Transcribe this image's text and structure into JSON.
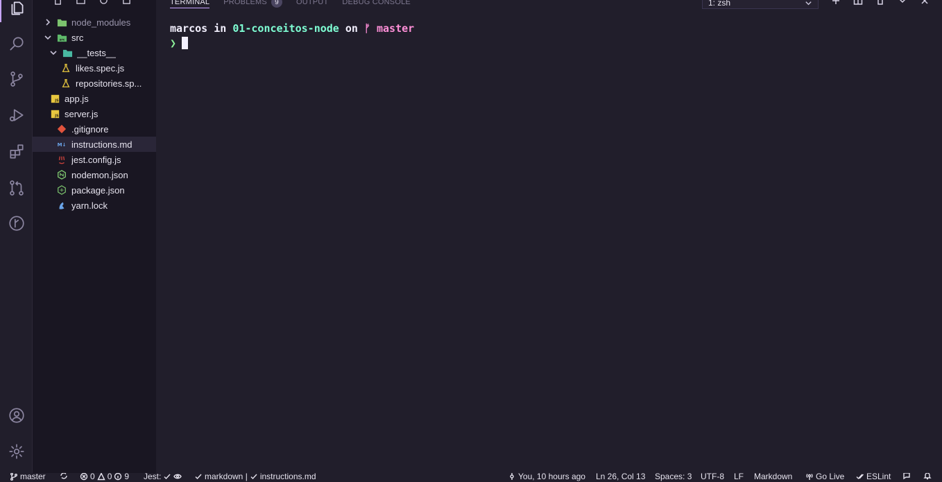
{
  "activity_bar": {
    "items": [
      {
        "icon": "explorer-icon",
        "active": true
      },
      {
        "icon": "search-icon"
      },
      {
        "icon": "source-control-icon"
      },
      {
        "icon": "run-debug-icon"
      },
      {
        "icon": "extensions-icon"
      },
      {
        "icon": "pull-request-icon"
      },
      {
        "icon": "git-graph-icon"
      }
    ],
    "bottom": [
      {
        "icon": "account-icon"
      },
      {
        "icon": "gear-icon"
      }
    ]
  },
  "explorer": {
    "tree": [
      {
        "label": "node_modules",
        "icon": "folder-node-icon",
        "chevron": "right",
        "indent": 1,
        "dim": true
      },
      {
        "label": "src",
        "icon": "folder-src-icon",
        "chevron": "down",
        "indent": 1
      },
      {
        "label": "__tests__",
        "icon": "folder-tests-icon",
        "chevron": "down",
        "indent": 2
      },
      {
        "label": "likes.spec.js",
        "icon": "test-flask-icon",
        "indent": 3
      },
      {
        "label": "repositories.sp...",
        "icon": "test-flask-icon",
        "indent": 3
      },
      {
        "label": "app.js",
        "icon": "js-file-icon",
        "indent": 2
      },
      {
        "label": "server.js",
        "icon": "js-file-icon",
        "indent": 2
      },
      {
        "label": ".gitignore",
        "icon": "git-icon",
        "indent": 1
      },
      {
        "label": "instructions.md",
        "icon": "markdown-icon",
        "indent": 1,
        "selected": true
      },
      {
        "label": "jest.config.js",
        "icon": "jest-icon",
        "indent": 1
      },
      {
        "label": "nodemon.json",
        "icon": "nodemon-icon",
        "indent": 1
      },
      {
        "label": "package.json",
        "icon": "npm-package-icon",
        "indent": 1
      },
      {
        "label": "yarn.lock",
        "icon": "yarn-icon",
        "indent": 1
      }
    ]
  },
  "panel": {
    "tabs": [
      {
        "label": "TERMINAL",
        "active": true
      },
      {
        "label": "PROBLEMS",
        "badge": "9"
      },
      {
        "label": "OUTPUT"
      },
      {
        "label": "DEBUG CONSOLE"
      }
    ],
    "terminal_select": "1: zsh"
  },
  "terminal": {
    "user": "marcos",
    "in_word": " in ",
    "dir": "01-conceitos-node",
    "on_word": " on ",
    "branch_glyph": "ᚠ ",
    "branch": "master",
    "prompt": "❯"
  },
  "status_bar": {
    "branch": "master",
    "errors": "0",
    "warnings": "0",
    "infos": "9",
    "jest": "Jest:",
    "markdown_check": "markdown |",
    "file_check": "instructions.md",
    "blame": "You, 10 hours ago",
    "position": "Ln 26, Col 13",
    "spaces": "Spaces: 3",
    "encoding": "UTF-8",
    "eol": "LF",
    "language": "Markdown",
    "go_live": "Go Live",
    "eslint": "ESLint"
  },
  "colors": {
    "background": "#211e2b",
    "sidebar": "#191622",
    "accent": "#c7a5ff",
    "terminal_dir": "#7fffd4",
    "terminal_branch": "#ff8fd8",
    "terminal_prompt": "#8df29a"
  }
}
